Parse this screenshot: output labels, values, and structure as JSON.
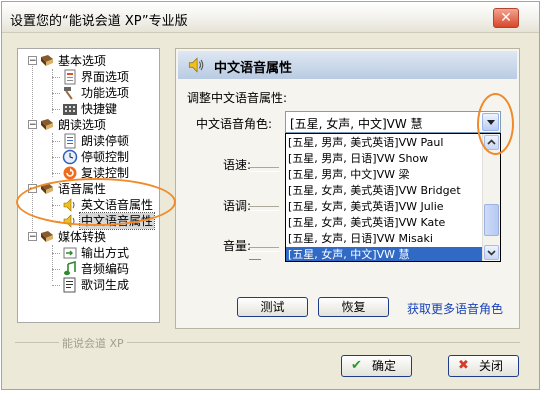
{
  "window": {
    "title": "设置您的“能说会道 XP”专业版",
    "close_glyph": "✕"
  },
  "tree": {
    "groups": [
      {
        "label": "基本选项",
        "items": [
          "界面选项",
          "功能选项",
          "快捷键"
        ]
      },
      {
        "label": "朗读选项",
        "items": [
          "朗读停顿",
          "停顿控制",
          "复读控制"
        ]
      },
      {
        "label": "语音属性",
        "items": [
          "英文语音属性",
          "中文语音属性"
        ]
      },
      {
        "label": "媒体转换",
        "items": [
          "输出方式",
          "音频编码",
          "歌词生成"
        ]
      }
    ],
    "toggle": "−"
  },
  "panel": {
    "title": "中文语音属性",
    "group_label": "调整中文语音属性:",
    "voice_label": "中文语音角色:",
    "voice_value": "[五星, 女声, 中文]VW 慧",
    "speed_label": "语速:",
    "pitch_label": "语调:",
    "volume_label": "音量:",
    "test_button": "测试",
    "restore_button": "恢复",
    "more_link": "获取更多语音角色",
    "options": [
      "[五星, 男声, 美式英语]VW Paul",
      "[五星, 男声, 日语]VW Show",
      "[五星, 男声, 中文]VW 梁",
      "[五星, 女声, 美式英语]VW Bridget",
      "[五星, 女声, 美式英语]VW Julie",
      "[五星, 女声, 美式英语]VW Kate",
      "[五星, 女声, 日语]VW Misaki",
      "[五星, 女声, 中文]VW 慧"
    ],
    "selected_index": 7
  },
  "footer": {
    "brand": "能说会道 XP"
  },
  "buttons": {
    "ok": "确定",
    "close": "关闭"
  },
  "colors": {
    "accent": "#316ac5",
    "highlight_ring": "#f08a2a",
    "link": "#1842b8"
  }
}
